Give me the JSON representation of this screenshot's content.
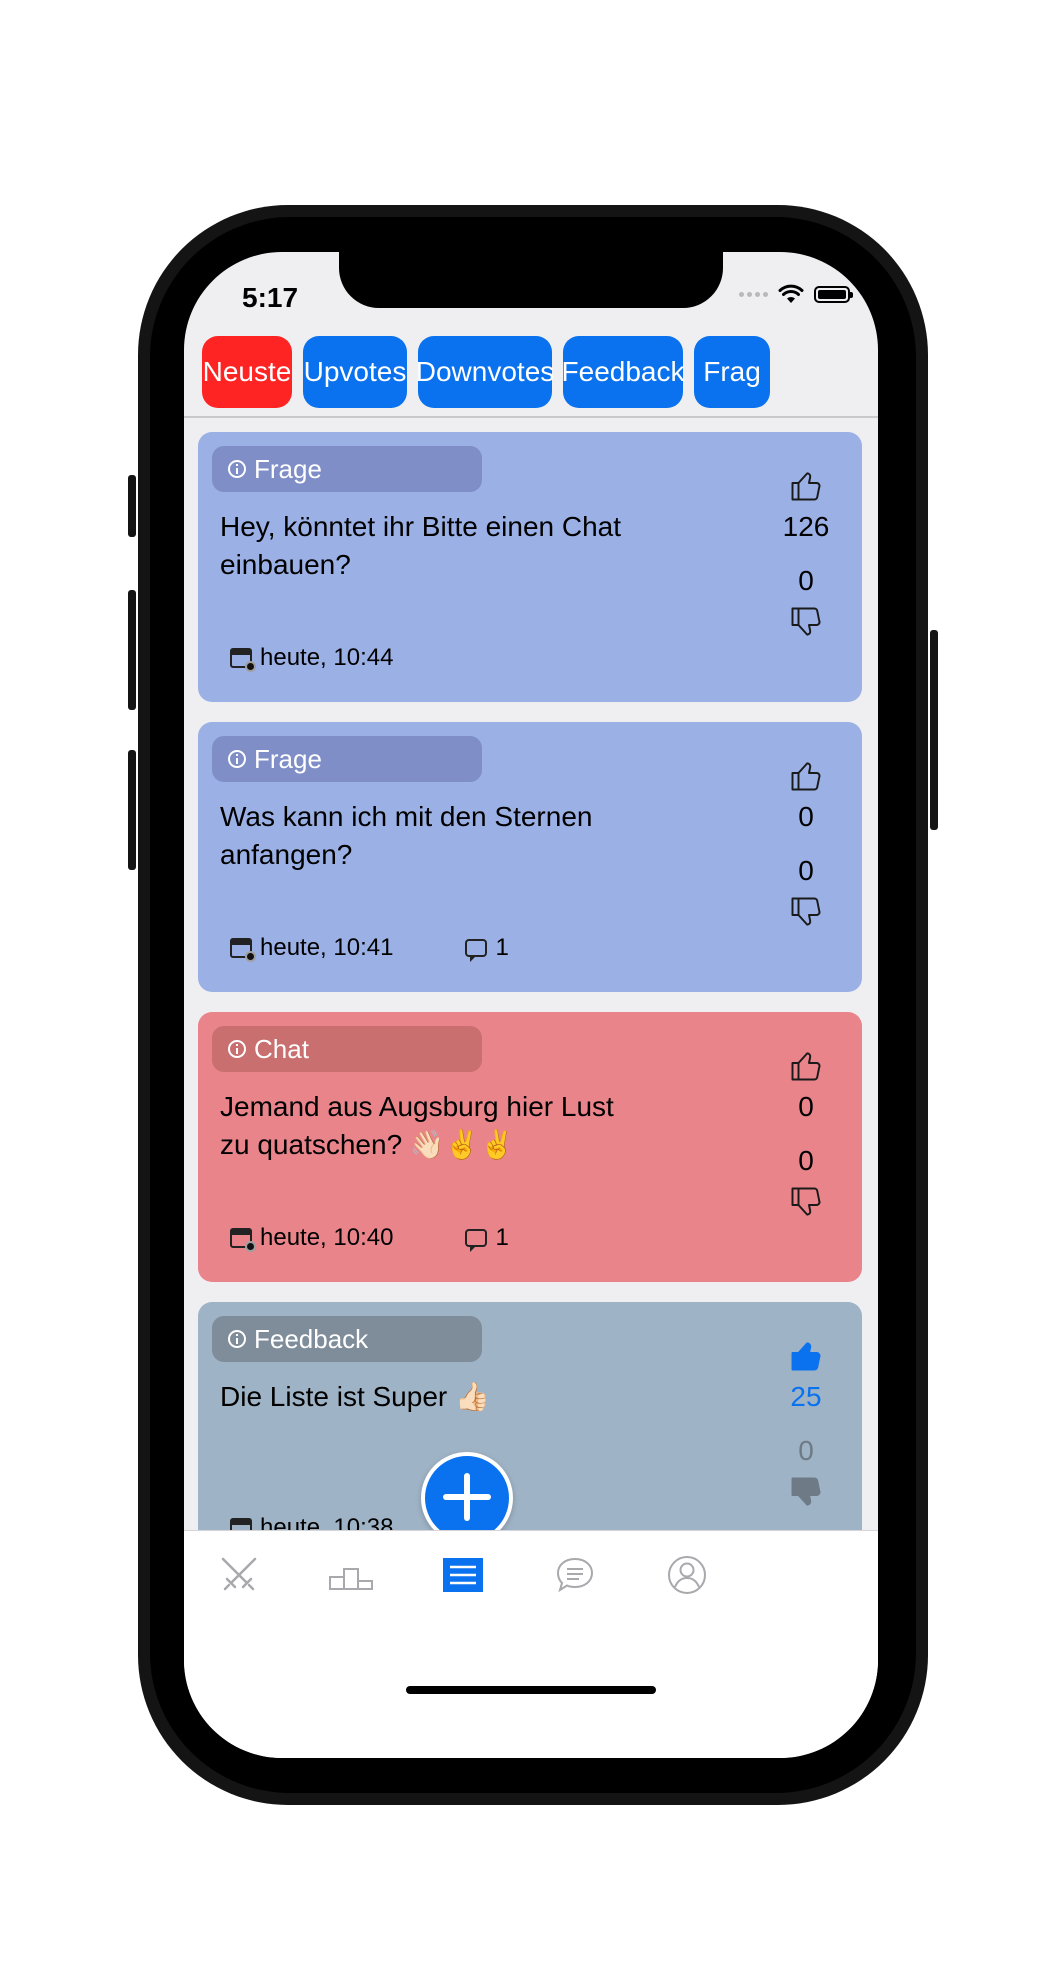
{
  "status": {
    "time": "5:17"
  },
  "filters": [
    {
      "label": "Neuste",
      "active": true
    },
    {
      "label": "Upvotes",
      "active": false
    },
    {
      "label": "Downvotes",
      "active": false
    },
    {
      "label": "Feedback",
      "active": false
    },
    {
      "label": "Frag",
      "active": false
    }
  ],
  "posts": [
    {
      "category": "Frage",
      "text": "Hey, könntet ihr Bitte einen Chat einbauen?",
      "date": "heute, 10:44",
      "comments": "",
      "upvotes": "126",
      "downvotes": "0",
      "color": "#9bb0e5",
      "tag_color": "#7f8ec7",
      "voted_up": false
    },
    {
      "category": "Frage",
      "text": "Was kann ich mit den Sternen anfangen?",
      "date": "heute, 10:41",
      "comments": "1",
      "upvotes": "0",
      "downvotes": "0",
      "color": "#9bb0e5",
      "tag_color": "#7f8ec7",
      "voted_up": false
    },
    {
      "category": "Chat",
      "text": "Jemand aus Augsburg hier Lust zu quatschen? 👋🏻✌️✌️",
      "date": "heute, 10:40",
      "comments": "1",
      "upvotes": "0",
      "downvotes": "0",
      "color": "#e9848b",
      "tag_color": "#c96f6f",
      "voted_up": false
    },
    {
      "category": "Feedback",
      "text": "Die Liste ist Super 👍🏻",
      "date": "heute, 10:38",
      "comments": "",
      "upvotes": "25",
      "downvotes": "0",
      "color": "#9fb3c6",
      "tag_color": "#7f8d9b",
      "voted_up": true
    }
  ],
  "tabbar": {
    "items": [
      {
        "icon": "swords-icon",
        "active": false
      },
      {
        "icon": "podium-icon",
        "active": false
      },
      {
        "icon": "list-icon",
        "active": true
      },
      {
        "icon": "chat-icon",
        "active": false
      },
      {
        "icon": "profile-icon",
        "active": false
      }
    ]
  },
  "colors": {
    "accent": "#0a72ee",
    "active_filter": "#ff2424",
    "inactive_icon": "#a8a8ad"
  }
}
